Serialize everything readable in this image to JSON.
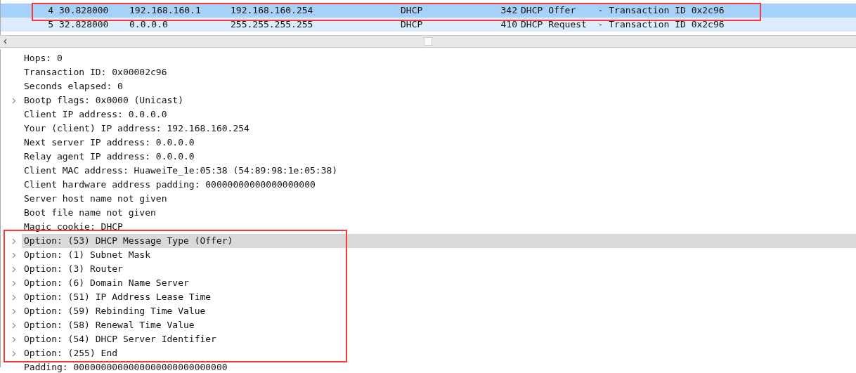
{
  "packet_list": {
    "rows": [
      {
        "no": "4",
        "time": "30.828000",
        "source": "192.168.160.1",
        "destination": "192.168.160.254",
        "protocol": "DHCP",
        "length": "342",
        "info": "DHCP Offer    - Transaction ID 0x2c96",
        "selected": true
      },
      {
        "no": "5",
        "time": "32.828000",
        "source": "0.0.0.0",
        "destination": "255.255.255.255",
        "protocol": "DHCP",
        "length": "410",
        "info": "DHCP Request  - Transaction ID 0x2c96",
        "selected": false
      }
    ]
  },
  "details": {
    "rows": [
      {
        "text": "Hops: 0",
        "expandable": false,
        "selected": false
      },
      {
        "text": "Transaction ID: 0x00002c96",
        "expandable": false,
        "selected": false
      },
      {
        "text": "Seconds elapsed: 0",
        "expandable": false,
        "selected": false
      },
      {
        "text": "Bootp flags: 0x0000 (Unicast)",
        "expandable": true,
        "selected": false
      },
      {
        "text": "Client IP address: 0.0.0.0",
        "expandable": false,
        "selected": false
      },
      {
        "text": "Your (client) IP address: 192.168.160.254",
        "expandable": false,
        "selected": false
      },
      {
        "text": "Next server IP address: 0.0.0.0",
        "expandable": false,
        "selected": false
      },
      {
        "text": "Relay agent IP address: 0.0.0.0",
        "expandable": false,
        "selected": false
      },
      {
        "text": "Client MAC address: HuaweiTe_1e:05:38 (54:89:98:1e:05:38)",
        "expandable": false,
        "selected": false
      },
      {
        "text": "Client hardware address padding: 00000000000000000000",
        "expandable": false,
        "selected": false
      },
      {
        "text": "Server host name not given",
        "expandable": false,
        "selected": false
      },
      {
        "text": "Boot file name not given",
        "expandable": false,
        "selected": false
      },
      {
        "text": "Magic cookie: DHCP",
        "expandable": false,
        "selected": false
      },
      {
        "text": "Option: (53) DHCP Message Type (Offer)",
        "expandable": true,
        "selected": true
      },
      {
        "text": "Option: (1) Subnet Mask",
        "expandable": true,
        "selected": false
      },
      {
        "text": "Option: (3) Router",
        "expandable": true,
        "selected": false
      },
      {
        "text": "Option: (6) Domain Name Server",
        "expandable": true,
        "selected": false
      },
      {
        "text": "Option: (51) IP Address Lease Time",
        "expandable": true,
        "selected": false
      },
      {
        "text": "Option: (59) Rebinding Time Value",
        "expandable": true,
        "selected": false
      },
      {
        "text": "Option: (58) Renewal Time Value",
        "expandable": true,
        "selected": false
      },
      {
        "text": "Option: (54) DHCP Server Identifier",
        "expandable": true,
        "selected": false
      },
      {
        "text": "Option: (255) End",
        "expandable": true,
        "selected": false
      },
      {
        "text": "Padding: 0000000000000000000000000000",
        "expandable": false,
        "selected": false
      }
    ]
  }
}
